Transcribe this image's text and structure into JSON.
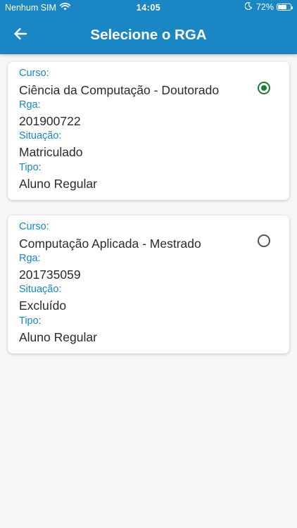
{
  "status_bar": {
    "carrier": "Nenhum SIM",
    "time": "14:05",
    "battery_percent": "72%",
    "battery_level": 0.72,
    "icons": [
      "wifi-icon",
      "moon-icon",
      "battery-icon"
    ]
  },
  "header": {
    "title": "Selecione o RGA",
    "back_icon": "arrow-left-icon",
    "background": "#1a86c3"
  },
  "labels": {
    "curso": "Curso:",
    "rga": "Rga:",
    "situacao": "Situação:",
    "tipo": "Tipo:"
  },
  "rgas": [
    {
      "curso": "Ciência da Computação - Doutorado",
      "rga": "201900722",
      "situacao": "Matriculado",
      "tipo": "Aluno Regular",
      "selected": true
    },
    {
      "curso": "Computação Aplicada - Mestrado",
      "rga": "201735059",
      "situacao": "Excluído",
      "tipo": "Aluno Regular",
      "selected": false
    }
  ],
  "colors": {
    "accent": "#1a86c3",
    "radio_selected": "#1f7a36",
    "text": "#2b2b2b"
  }
}
